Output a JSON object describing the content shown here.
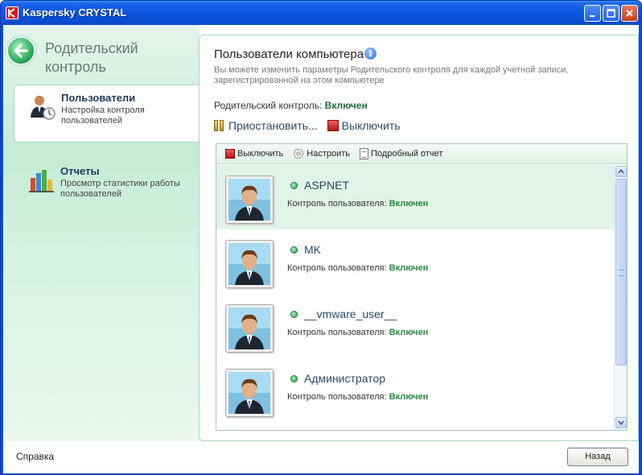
{
  "window": {
    "title": "Kaspersky CRYSTAL",
    "app_icon": "kaspersky-k-icon",
    "buttons": [
      "minimize-icon",
      "maximize-icon",
      "close-icon"
    ]
  },
  "sidebar": {
    "section_title": "Родительский контроль",
    "back_icon": "arrow-left-icon",
    "items": [
      {
        "title": "Пользователи",
        "desc": "Настройка контроля пользователей",
        "icon": "users-icon",
        "active": true
      },
      {
        "title": "Отчеты",
        "desc": "Просмотр статистики работы пользователей",
        "icon": "bar-chart-icon",
        "active": false
      }
    ]
  },
  "main": {
    "title": "Пользователи компьютера",
    "description": "Вы можете изменить параметры Родительского контроля для каждой учетной записи, зарегистрированной на этом компьютере",
    "status_label": "Родительский контроль:",
    "status_value": "Включен",
    "actions": {
      "pause": "Приостановить...",
      "disable": "Выключить"
    },
    "list_toolbar": {
      "disable": "Выключить",
      "configure": "Настроить",
      "report": "Подробный отчет"
    },
    "users": [
      {
        "name": "ASPNET",
        "status_label": "Контроль пользователя:",
        "status_value": "Включен",
        "selected": true
      },
      {
        "name": "MK",
        "status_label": "Контроль пользователя:",
        "status_value": "Включен",
        "selected": false
      },
      {
        "name": "__vmware_user__",
        "status_label": "Контроль пользователя:",
        "status_value": "Включен",
        "selected": false
      },
      {
        "name": "Администратор",
        "status_label": "Контроль пользователя:",
        "status_value": "Включен",
        "selected": false
      }
    ]
  },
  "footer": {
    "help": "Справка",
    "back": "Назад"
  },
  "colors": {
    "titlebar": "#0c55de",
    "sidebar_green": "#c5ecd5",
    "status_green": "#2a8a3e",
    "selected_row": "#e1f4e8"
  }
}
